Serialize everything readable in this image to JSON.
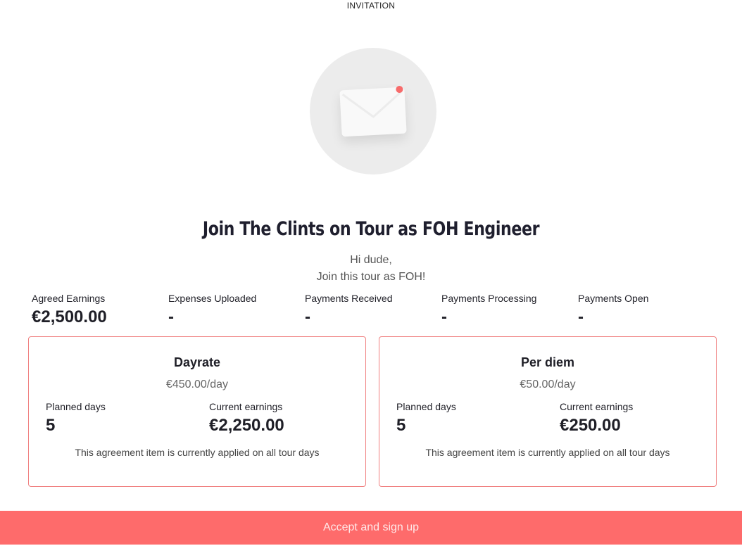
{
  "header": {
    "label": "INVITATION"
  },
  "hero": {
    "icon": "envelope-icon",
    "notification_color": "#f76b6b"
  },
  "invitation": {
    "title": "Join The Clints on Tour as FOH Engineer",
    "greeting": "Hi dude,",
    "message": "Join this tour as FOH!"
  },
  "stats": [
    {
      "label": "Agreed Earnings",
      "value": "€2,500.00"
    },
    {
      "label": "Expenses Uploaded",
      "value": "-"
    },
    {
      "label": "Payments Received",
      "value": "-"
    },
    {
      "label": "Payments Processing",
      "value": "-"
    },
    {
      "label": "Payments Open",
      "value": "-"
    }
  ],
  "agreements": [
    {
      "title": "Dayrate",
      "rate": "€450.00/day",
      "planned_days_label": "Planned days",
      "planned_days": "5",
      "current_earnings_label": "Current earnings",
      "current_earnings": "€2,250.00",
      "note": "This agreement item is currently applied on all tour days"
    },
    {
      "title": "Per diem",
      "rate": "€50.00/day",
      "planned_days_label": "Planned days",
      "planned_days": "5",
      "current_earnings_label": "Current earnings",
      "current_earnings": "€250.00",
      "note": "This agreement item is currently applied on all tour days"
    }
  ],
  "actions": {
    "accept_label": "Accept and sign up"
  },
  "colors": {
    "accent": "#fe6b6b",
    "card_border": "#f08080"
  }
}
